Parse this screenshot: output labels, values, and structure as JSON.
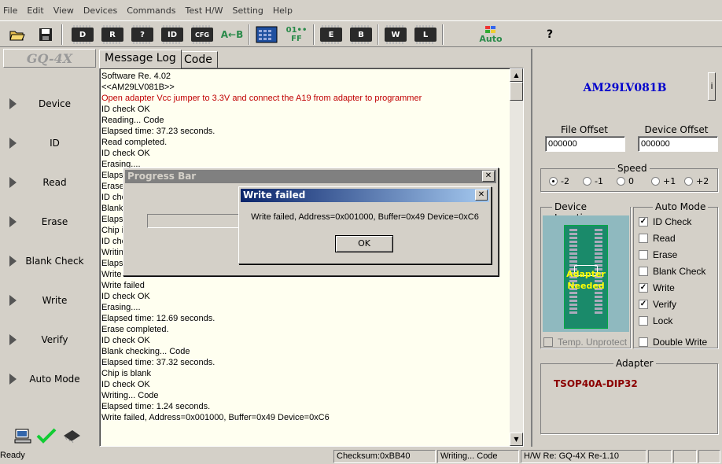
{
  "menubar": {
    "items": [
      "File",
      "Edit",
      "View",
      "Devices",
      "Commands",
      "Test H/W",
      "Setting",
      "Help"
    ]
  },
  "toolbar": {
    "buttons": [
      {
        "name": "open-icon",
        "label": ""
      },
      {
        "name": "save-icon",
        "label": ""
      },
      {
        "name": "device-chip-icon",
        "label": "D"
      },
      {
        "name": "read-chip-icon",
        "label": "R"
      },
      {
        "name": "verify-chip-icon",
        "label": "?"
      },
      {
        "name": "id-chip-icon",
        "label": "ID"
      },
      {
        "name": "cfg-chip-icon",
        "label": "CFG"
      },
      {
        "name": "a-b-compare-icon",
        "label": "A←B"
      },
      {
        "name": "hex-editor-icon",
        "label": ""
      },
      {
        "name": "binary-icon",
        "label": "01••FF"
      },
      {
        "name": "erase-chip-icon",
        "label": "E"
      },
      {
        "name": "blank-chip-icon",
        "label": "B"
      },
      {
        "name": "write-chip-icon",
        "label": "W"
      },
      {
        "name": "lock-chip-icon",
        "label": "L"
      },
      {
        "name": "auto-icon",
        "label": "Auto"
      },
      {
        "name": "help-icon",
        "label": "?"
      }
    ]
  },
  "leftnav": {
    "logo": "GQ-4X",
    "items": [
      "Device",
      "ID",
      "Read",
      "Erase",
      "Blank Check",
      "Write",
      "Verify",
      "Auto Mode"
    ]
  },
  "tabs": [
    "Message Log",
    "Code"
  ],
  "log": {
    "lines": [
      "Software Re. 4.02",
      "<<AM29LV081B>>",
      "Open adapter Vcc jumper to 3.3V and connect the A19 from adapter to programmer",
      "ID check OK",
      "Reading... Code",
      "Elapsed time: 37.23 seconds.",
      "Read completed.",
      "ID check OK",
      "Erasing....",
      "Elaps",
      "Erase",
      "ID che",
      "Blank",
      "Elaps",
      "Chip i",
      "ID che",
      "Writin",
      "Elaps",
      "Write",
      "Write failed",
      "ID check OK",
      "Erasing....",
      "Elapsed time: 12.69 seconds.",
      "Erase completed.",
      "ID check OK",
      "Blank checking... Code",
      "Elapsed time: 37.32 seconds.",
      "Chip is blank",
      "ID check OK",
      "Writing... Code",
      "Elapsed time: 1.24 seconds.",
      "Write failed, Address=0x001000, Buffer=0x49 Device=0xC6"
    ],
    "red_line_index": 2
  },
  "right": {
    "device_name": "AM29LV081B",
    "info_button": "i",
    "file_offset": {
      "label": "File Offset",
      "value": "000000"
    },
    "device_offset": {
      "label": "Device Offset",
      "value": "000000"
    },
    "speed": {
      "label": "Speed",
      "options": [
        "-2",
        "-1",
        "0",
        "+1",
        "+2"
      ],
      "selected": "-2"
    },
    "device_location": {
      "label": "Device Location",
      "adapter_text_1": "Adapter",
      "adapter_text_2": "Needed"
    },
    "temp_unprotect": {
      "label": "Temp. Unprotect",
      "checked": false
    },
    "auto_mode": {
      "label": "Auto Mode",
      "items": [
        {
          "label": "ID Check",
          "checked": true
        },
        {
          "label": "Read",
          "checked": false
        },
        {
          "label": "Erase",
          "checked": false
        },
        {
          "label": "Blank Check",
          "checked": false
        },
        {
          "label": "Write",
          "checked": true
        },
        {
          "label": "Verify",
          "checked": true
        },
        {
          "label": "Lock",
          "checked": false
        }
      ]
    },
    "double_write": {
      "label": "Double Write",
      "checked": false
    },
    "adapter": {
      "label": "Adapter",
      "value": "TSOP40A-DIP32"
    }
  },
  "progress_dialog": {
    "title": "Progress Bar",
    "close": "✕"
  },
  "error_dialog": {
    "title": "Write failed",
    "message": "Write failed, Address=0x001000, Buffer=0x49 Device=0xC6",
    "ok": "OK",
    "close": "✕"
  },
  "statusbar": {
    "ready": "Ready",
    "checksum": "Checksum:0xBB40",
    "operation": "Writing... Code",
    "hw": "H/W Re: GQ-4X Re-1.10"
  },
  "colors": {
    "title_active": "#0a246a",
    "title_active_end": "#a6caf0",
    "title_inactive": "#808080",
    "device_name": "#0000cc",
    "adapter_text": "#8b0000",
    "log_red": "#c00000",
    "log_bg": "#fffff0"
  }
}
